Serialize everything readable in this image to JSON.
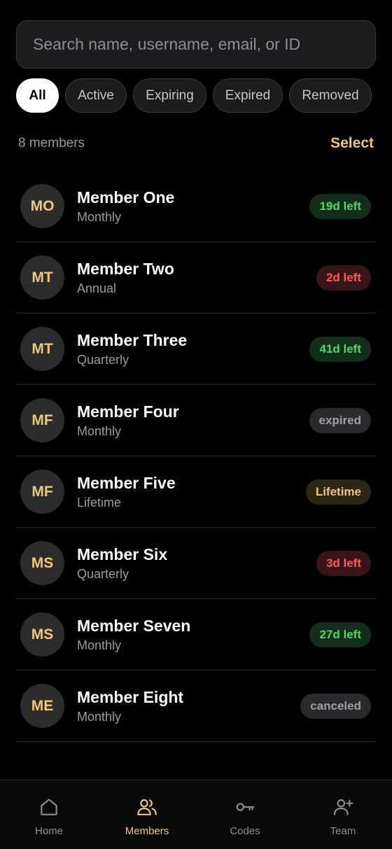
{
  "search": {
    "placeholder": "Search name, username, email, or ID"
  },
  "filters": [
    {
      "label": "All",
      "active": true
    },
    {
      "label": "Active",
      "active": false
    },
    {
      "label": "Expiring",
      "active": false
    },
    {
      "label": "Expired",
      "active": false
    },
    {
      "label": "Removed",
      "active": false
    }
  ],
  "summary": {
    "count_label": "8 members",
    "select_label": "Select"
  },
  "members": [
    {
      "initials": "MO",
      "name": "Member One",
      "plan": "Monthly",
      "status": "19d left",
      "status_type": "green"
    },
    {
      "initials": "MT",
      "name": "Member Two",
      "plan": "Annual",
      "status": "2d left",
      "status_type": "red"
    },
    {
      "initials": "MT",
      "name": "Member Three",
      "plan": "Quarterly",
      "status": "41d left",
      "status_type": "green"
    },
    {
      "initials": "MF",
      "name": "Member Four",
      "plan": "Monthly",
      "status": "expired",
      "status_type": "gray"
    },
    {
      "initials": "MF",
      "name": "Member Five",
      "plan": "Lifetime",
      "status": "Lifetime",
      "status_type": "gold"
    },
    {
      "initials": "MS",
      "name": "Member Six",
      "plan": "Quarterly",
      "status": "3d left",
      "status_type": "red"
    },
    {
      "initials": "MS",
      "name": "Member Seven",
      "plan": "Monthly",
      "status": "27d left",
      "status_type": "green"
    },
    {
      "initials": "ME",
      "name": "Member Eight",
      "plan": "Monthly",
      "status": "canceled",
      "status_type": "gray"
    }
  ],
  "tabs": [
    {
      "label": "Home",
      "icon": "home-icon",
      "active": false
    },
    {
      "label": "Members",
      "icon": "members-icon",
      "active": true
    },
    {
      "label": "Codes",
      "icon": "key-icon",
      "active": false
    },
    {
      "label": "Team",
      "icon": "add-person-icon",
      "active": false
    }
  ],
  "colors": {
    "accent": "#f0c77a",
    "background": "#000000",
    "green": "#4cd964",
    "red": "#ff5a52"
  }
}
